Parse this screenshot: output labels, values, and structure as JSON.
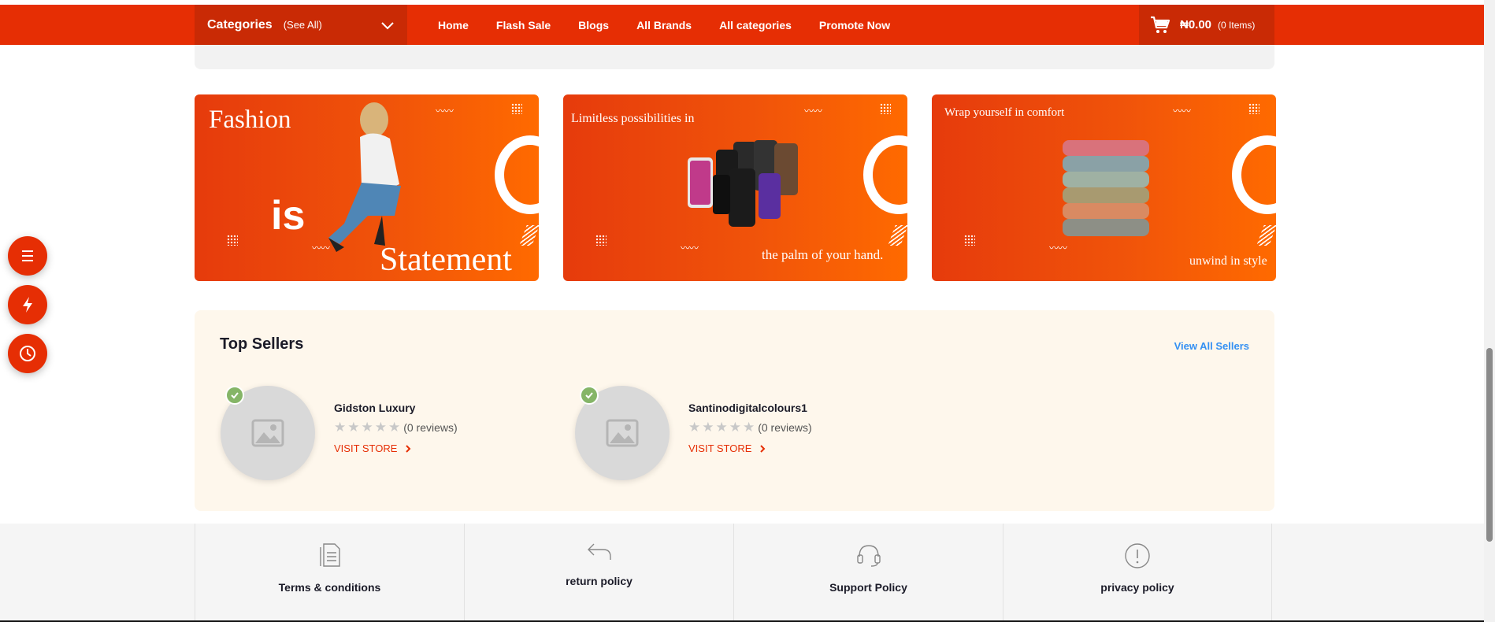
{
  "nav": {
    "categories_title": "Categories",
    "categories_see_all": "(See All)",
    "links": [
      "Home",
      "Flash Sale",
      "Blogs",
      "All Brands",
      "All categories",
      "Promote Now"
    ],
    "cart_amount": "₦0.00",
    "cart_items": "(0 Items)"
  },
  "banners": [
    {
      "line1": "Fashion",
      "line2": "is",
      "line3": "Statement"
    },
    {
      "line1": "Limitless possibilities in",
      "line2": "the palm of your hand."
    },
    {
      "line1": "Wrap yourself in comfort",
      "line2": "unwind in style"
    }
  ],
  "top_sellers": {
    "title": "Top Sellers",
    "view_all": "View All Sellers",
    "sellers": [
      {
        "name": "Gidston Luxury",
        "reviews": "(0 reviews)",
        "visit": "VISIT STORE"
      },
      {
        "name": "Santinodigitalcolours1",
        "reviews": "(0 reviews)",
        "visit": "VISIT STORE"
      }
    ]
  },
  "policies": [
    "Terms & conditions",
    "return policy",
    "Support Policy",
    "privacy policy"
  ],
  "colors": {
    "brand": "#e62e04",
    "brand_dark": "#c92a05",
    "link_blue": "#3490f3",
    "verified_green": "#85b567",
    "sellers_bg": "#fef7ec"
  },
  "icons": {
    "float_buttons": [
      "menu-icon",
      "flash-icon",
      "clock-icon"
    ],
    "policy_icons": [
      "document-icon",
      "return-arrow-icon",
      "headset-icon",
      "exclamation-icon"
    ]
  }
}
